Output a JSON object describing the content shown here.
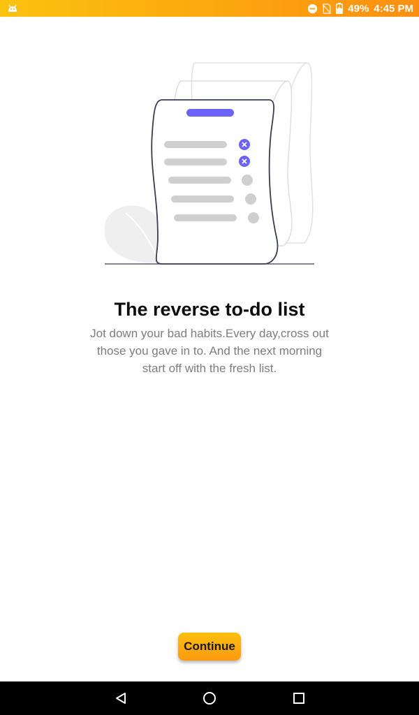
{
  "status_bar": {
    "battery": "49%",
    "time": "4:45 PM",
    "icons": [
      "android-icon",
      "dnd-icon",
      "no-sim-icon",
      "battery-charging-icon"
    ]
  },
  "onboarding": {
    "title": "The reverse to-do list",
    "description": "Jot down your bad habits.Every day,cross out those you gave in to. And the next morning start off with the fresh list.",
    "continue_label": "Continue"
  },
  "illustration": {
    "name": "reverse-todo-list-illustration",
    "accent": "#6c63ff",
    "checked_items": 2,
    "unchecked_items": 3
  },
  "nav_bar": {
    "icons": [
      "back-icon",
      "home-icon",
      "recents-icon"
    ]
  },
  "colors": {
    "status_gradient_start": "#fbc20f",
    "status_gradient_end": "#fd8f10",
    "button": "#fca30f",
    "accent": "#6c63ff"
  }
}
